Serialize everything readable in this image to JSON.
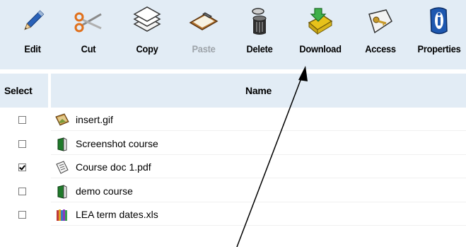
{
  "toolbar": {
    "items": [
      {
        "label": "Edit",
        "icon": "pencil-icon",
        "enabled": true
      },
      {
        "label": "Cut",
        "icon": "scissors-icon",
        "enabled": true
      },
      {
        "label": "Copy",
        "icon": "copy-icon",
        "enabled": true
      },
      {
        "label": "Paste",
        "icon": "clipboard-icon",
        "enabled": false
      },
      {
        "label": "Delete",
        "icon": "trash-can-icon",
        "enabled": true
      },
      {
        "label": "Download",
        "icon": "download-folder-icon",
        "enabled": true
      },
      {
        "label": "Access",
        "icon": "key-icon",
        "enabled": true
      },
      {
        "label": "Properties",
        "icon": "info-icon",
        "enabled": true
      }
    ]
  },
  "table": {
    "headers": {
      "select": "Select",
      "name": "Name"
    },
    "rows": [
      {
        "name": "insert.gif",
        "icon": "image-file-icon",
        "checked": false
      },
      {
        "name": "Screenshot course",
        "icon": "course-book-icon",
        "checked": false
      },
      {
        "name": "Course doc 1.pdf",
        "icon": "document-icon",
        "checked": true
      },
      {
        "name": "demo course",
        "icon": "course-book-icon",
        "checked": false
      },
      {
        "name": "LEA term dates.xls",
        "icon": "spreadsheet-books-icon",
        "checked": false
      }
    ]
  },
  "colors": {
    "header_bg": "#e2ecf5",
    "disabled_text": "#9ea4aa"
  }
}
